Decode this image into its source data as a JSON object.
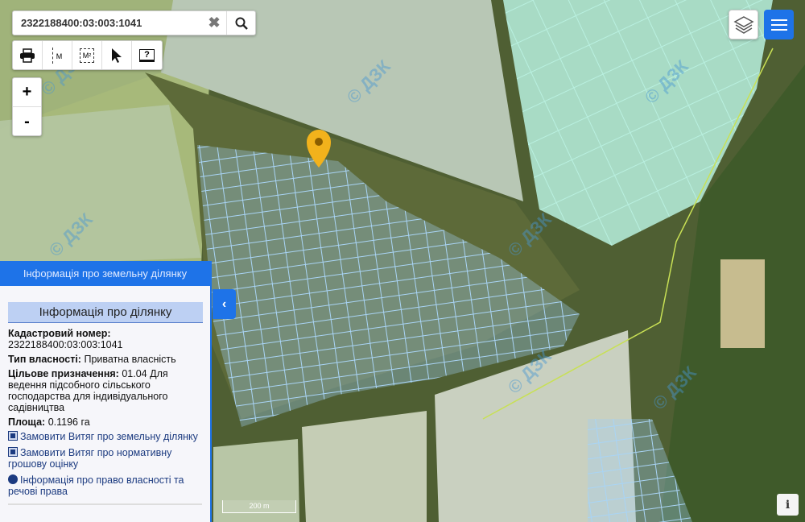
{
  "search": {
    "value": "2322188400:03:003:1041",
    "clear_icon": "close-icon",
    "search_icon": "search-icon"
  },
  "tools": [
    "print-icon",
    "measure-distance-icon",
    "measure-area-icon",
    "select-cursor-icon",
    "help-icon"
  ],
  "tool_labels": {
    "distance": "M",
    "area": "M²",
    "help": "?"
  },
  "zoom": {
    "in": "+",
    "out": "-"
  },
  "watermark": "© ДЗК",
  "panel": {
    "header": "Інформація про земельну ділянку",
    "subheader": "Інформація про ділянку",
    "cadastral_label": "Кадастровий номер:",
    "cadastral_value": "2322188400:03:003:1041",
    "ownership_label": "Тип власності:",
    "ownership_value": "Приватна власність",
    "purpose_label": "Цільове призначення:",
    "purpose_value": "01.04 Для ведення підсобного сільського господарства для індивідуального садівництва",
    "area_label": "Площа:",
    "area_value": "0.1196 га",
    "links": [
      "Замовити Витяг про земельну ділянку",
      "Замовити Витяг про нормативну грошову оцінку",
      "Інформація про право власності та речові права"
    ]
  },
  "collapse": "‹",
  "scale": "200 m",
  "info": "i",
  "colors": {
    "accent": "#1e73e8",
    "marker": "#f2b21c",
    "parcel": "#8fc4ee"
  }
}
